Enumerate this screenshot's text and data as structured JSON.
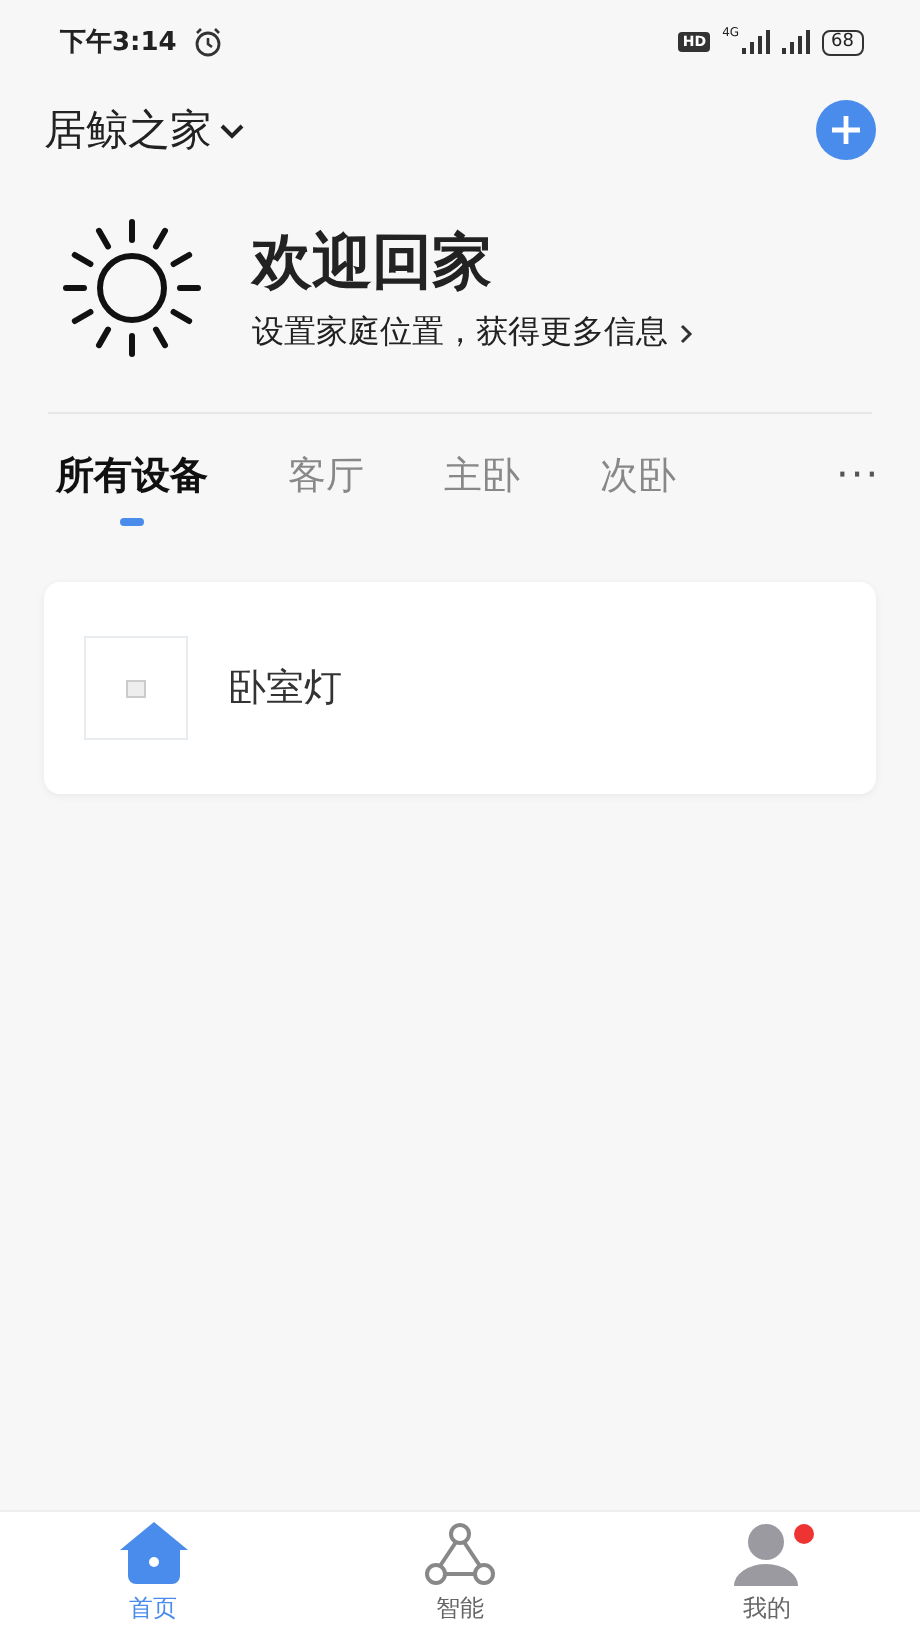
{
  "status_bar": {
    "time": "下午3:14",
    "hd": "HD",
    "network": "4G",
    "battery": "68"
  },
  "header": {
    "home_name": "居鲸之家"
  },
  "welcome": {
    "title": "欢迎回家",
    "subtitle": "设置家庭位置，获得更多信息"
  },
  "tabs": [
    {
      "label": "所有设备",
      "selected": true
    },
    {
      "label": "客厅",
      "selected": false
    },
    {
      "label": "主卧",
      "selected": false
    },
    {
      "label": "次卧",
      "selected": false
    }
  ],
  "more": "···",
  "devices": [
    {
      "name": "卧室灯"
    }
  ],
  "nav": [
    {
      "kind": "home",
      "label": "首页",
      "selected": true,
      "badge": false
    },
    {
      "kind": "smart",
      "label": "智能",
      "selected": false,
      "badge": false
    },
    {
      "kind": "me",
      "label": "我的",
      "selected": false,
      "badge": true
    }
  ]
}
